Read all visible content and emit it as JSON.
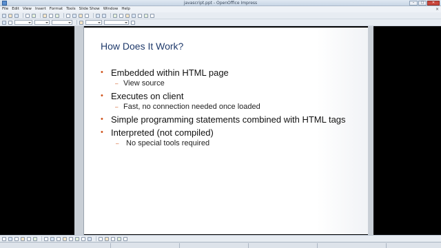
{
  "window": {
    "title": "javascript.ppt - OpenOffice Impress"
  },
  "menu": {
    "items": [
      "File",
      "Edit",
      "View",
      "Insert",
      "Format",
      "Tools",
      "Slide Show",
      "Window",
      "Help"
    ]
  },
  "slide": {
    "title": "How Does It Work?",
    "bullets": [
      {
        "text": "Embedded within HTML page",
        "sub": [
          "View source"
        ]
      },
      {
        "text": "Executes on client",
        "sub": [
          "Fast, no connection needed once loaded"
        ]
      },
      {
        "text": "Simple programming statements combined with HTML tags",
        "sub": []
      },
      {
        "text": "Interpreted (not compiled)",
        "sub": [
          "No special tools required"
        ]
      }
    ],
    "bullet_color": "#d0541c",
    "title_color": "#1f3a6b"
  },
  "icons": {
    "close": "close-icon",
    "bullet": "bullet-dot-icon",
    "sub_bullet": "dash-icon"
  }
}
